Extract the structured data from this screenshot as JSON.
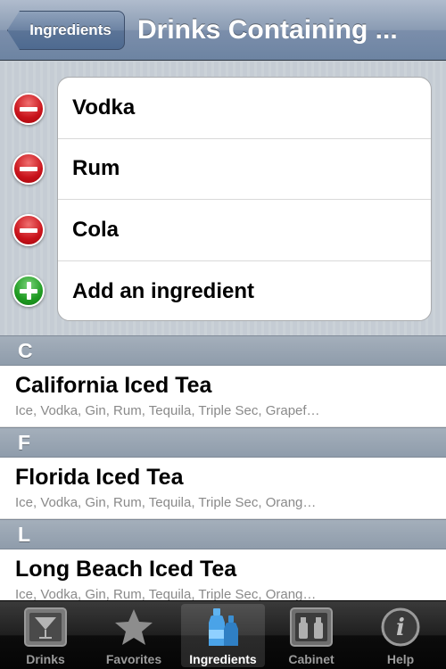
{
  "navbar": {
    "back_label": "Ingredients",
    "title": "Drinks Containing ..."
  },
  "selected_ingredients": [
    {
      "label": "Vodka",
      "control": "remove"
    },
    {
      "label": "Rum",
      "control": "remove"
    },
    {
      "label": "Cola",
      "control": "remove"
    },
    {
      "label": "Add an ingredient",
      "control": "add"
    }
  ],
  "sections": [
    {
      "letter": "C",
      "drink": {
        "name": "California Iced Tea",
        "ingredients": "Ice, Vodka, Gin, Rum, Tequila, Triple Sec, Grapef…"
      }
    },
    {
      "letter": "F",
      "drink": {
        "name": "Florida Iced Tea",
        "ingredients": "Ice, Vodka, Gin, Rum, Tequila, Triple Sec, Orang…"
      }
    },
    {
      "letter": "L",
      "drink": {
        "name": "Long Beach Iced Tea",
        "ingredients": "Ice, Vodka, Gin, Rum, Tequila, Triple Sec, Orang…"
      }
    }
  ],
  "tabbar": {
    "tabs": [
      {
        "label": "Drinks",
        "icon": "cocktail-glass-icon"
      },
      {
        "label": "Favorites",
        "icon": "star-icon"
      },
      {
        "label": "Ingredients",
        "icon": "bottles-icon"
      },
      {
        "label": "Cabinet",
        "icon": "cabinet-icon"
      },
      {
        "label": "Help",
        "icon": "info-icon"
      }
    ],
    "selected": "Ingredients"
  },
  "colors": {
    "remove": "#c8121a",
    "add": "#1e9a21",
    "selected_tab_icon": "#4aa3e8"
  }
}
